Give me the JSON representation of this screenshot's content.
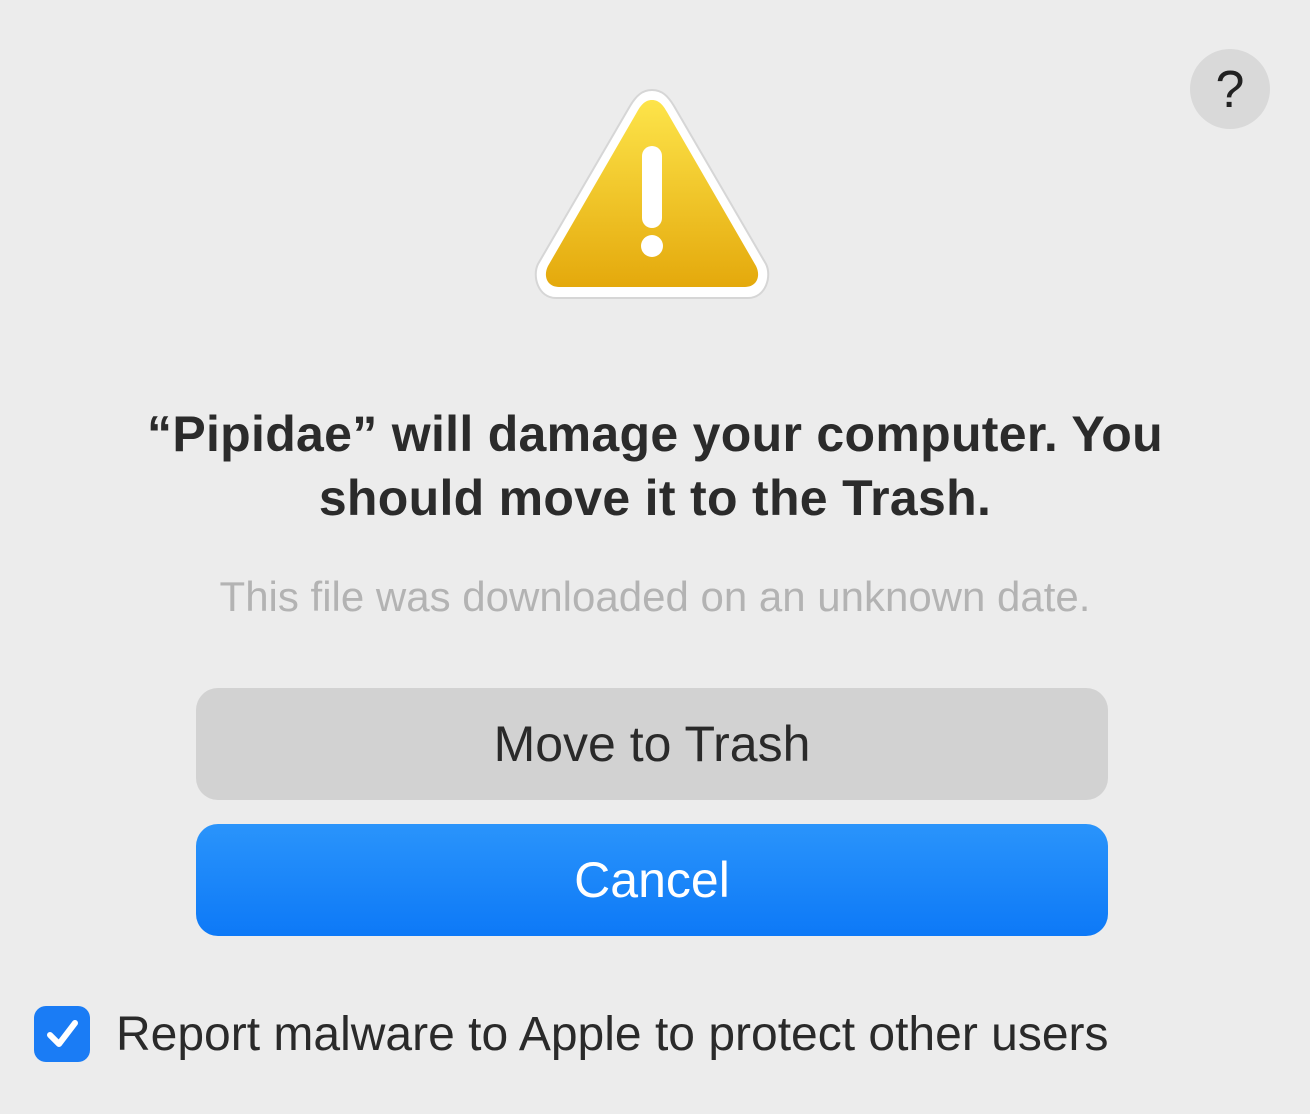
{
  "dialog": {
    "help_label": "?",
    "headline": "“Pipidae” will damage your computer. You should move it to the Trash.",
    "subtext": "This file was downloaded on an unknown date.",
    "move_to_trash_label": "Move to Trash",
    "cancel_label": "Cancel",
    "report_checkbox_label": "Report malware to Apple to protect other users",
    "report_checkbox_checked": true
  },
  "icons": {
    "warning": "warning-triangle-icon",
    "help": "question-mark-icon",
    "checkmark": "checkmark-icon"
  },
  "colors": {
    "background": "#ececec",
    "accent": "#1a7cf5",
    "warning_yellow": "#f2c418",
    "secondary_button": "#d2d2d2"
  }
}
